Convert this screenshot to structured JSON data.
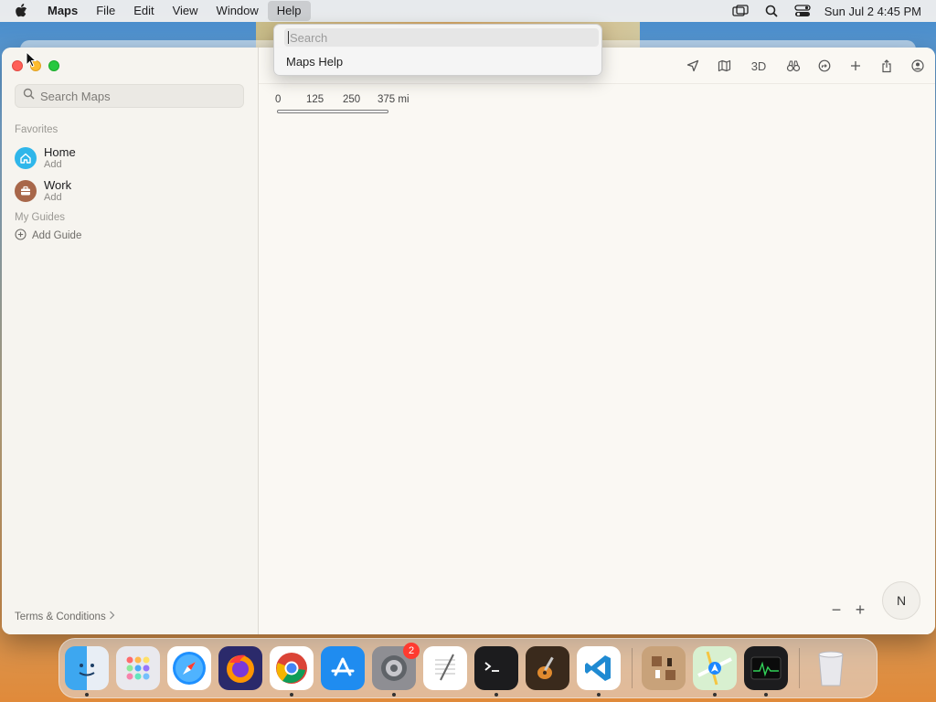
{
  "menubar": {
    "app_name": "Maps",
    "items": [
      "File",
      "Edit",
      "View",
      "Window",
      "Help"
    ],
    "clock": "Sun Jul 2  4:45 PM"
  },
  "help_menu": {
    "search_placeholder": "Search",
    "item": "Maps Help"
  },
  "sidebar": {
    "search_placeholder": "Search Maps",
    "favorites_label": "Favorites",
    "favorites": [
      {
        "name": "Home",
        "sub": "Add"
      },
      {
        "name": "Work",
        "sub": "Add"
      }
    ],
    "guides_label": "My Guides",
    "add_guide": "Add Guide",
    "terms": "Terms & Conditions"
  },
  "map": {
    "toolbar": {
      "threed": "3D"
    },
    "scale": [
      "0",
      "125",
      "250",
      "375 mi"
    ],
    "compass": "N",
    "zoom_out": "−",
    "zoom_in": "+"
  },
  "dock": {
    "settings_badge": "2"
  },
  "colors": {
    "home_icon": "#2fb6ea",
    "work_icon": "#a8674a",
    "close": "#ff5f57",
    "minimize": "#febc2e",
    "maximize": "#28c840"
  }
}
